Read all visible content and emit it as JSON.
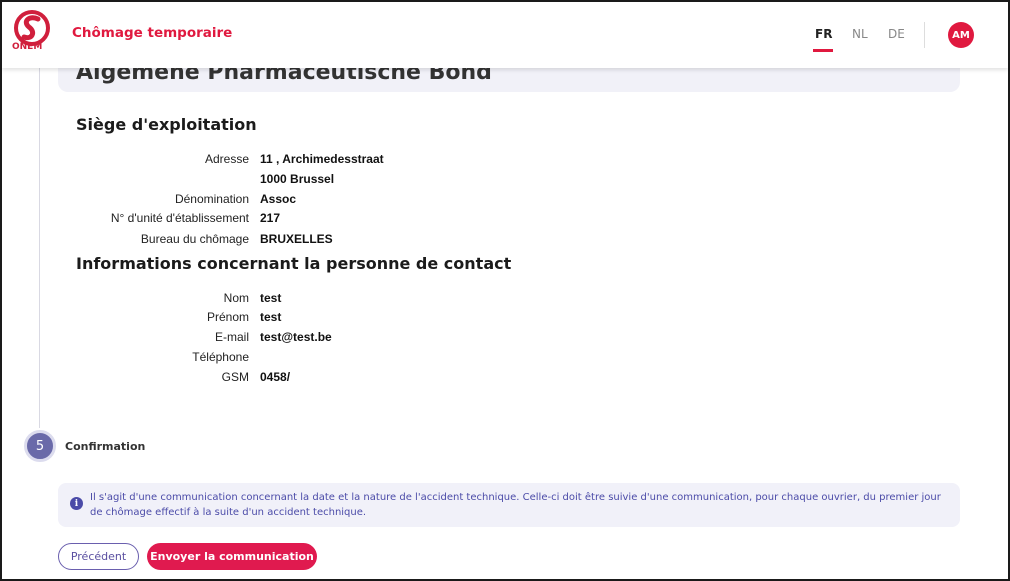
{
  "header": {
    "logo_text": "ONEM",
    "app_title": "Chômage temporaire",
    "languages": [
      {
        "code": "FR",
        "active": true
      },
      {
        "code": "NL",
        "active": false
      },
      {
        "code": "DE",
        "active": false
      }
    ],
    "avatar_initials": "AM",
    "brand_color": "#e0193f"
  },
  "top_card": {
    "title_partial": "Algemene Pharmaceutische Bond"
  },
  "siege": {
    "title": "Siège d'exploitation",
    "rows": [
      {
        "label": "Adresse",
        "value": "11 , Archimedesstraat"
      },
      {
        "label": "",
        "value": "1000 Brussel"
      },
      {
        "label": "Dénomination",
        "value": "Assoc"
      },
      {
        "label": "N° d'unité d'établissement",
        "value": "217"
      },
      {
        "label": "Bureau du chômage",
        "value": "BRUXELLES"
      }
    ]
  },
  "contact": {
    "title": "Informations concernant la personne de contact",
    "rows": [
      {
        "label": "Nom",
        "value": "test"
      },
      {
        "label": "Prénom",
        "value": "test"
      },
      {
        "label": "E-mail",
        "value": "test@test.be"
      },
      {
        "label": "Téléphone",
        "value": ""
      },
      {
        "label": "GSM",
        "value": "0458/"
      }
    ]
  },
  "step": {
    "number": "5",
    "label": "Confirmation"
  },
  "info": {
    "icon": "info-icon",
    "text": "Il s'agit d'une communication concernant la date et la nature de l'accident technique. Celle-ci doit être suivie d'une communication, pour chaque ouvrier, du premier jour de chômage effectif à la suite d'un accident technique."
  },
  "buttons": {
    "previous_label": "Précédent",
    "send_label": "Envoyer la communication"
  }
}
